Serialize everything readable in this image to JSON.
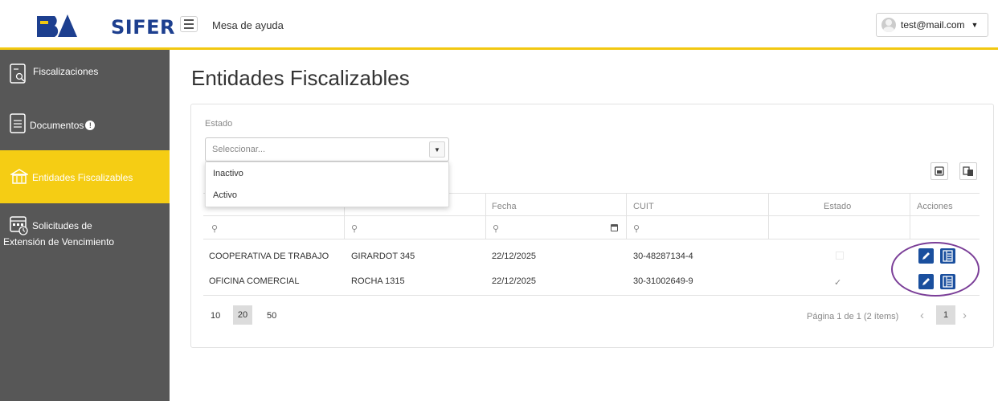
{
  "topbar": {
    "logo_text": "SIFER",
    "title": "Mesa de ayuda",
    "user_email": "test@mail.com",
    "accent_color": "#f2c811"
  },
  "sidebar": {
    "items": [
      {
        "label": "Fiscalizaciones",
        "icon": "document-search-icon"
      },
      {
        "label": "Documentos",
        "icon": "document-icon",
        "badge": "!"
      },
      {
        "label": "Entidades Fiscalizables",
        "icon": "building-icon",
        "active": true
      },
      {
        "label_line1": "Solicitudes de",
        "label_line2": "Extensión de Vencimiento",
        "icon": "calendar-clock-icon"
      }
    ],
    "active_color": "#f5cd14",
    "background": "#575757"
  },
  "main": {
    "title": "Entidades Fiscalizables",
    "filter": {
      "label": "Estado",
      "placeholder": "Seleccionar...",
      "options": [
        "Inactivo",
        "Activo"
      ]
    },
    "table": {
      "columns": [
        "",
        "",
        "Fecha",
        "CUIT",
        "Estado",
        "Acciones"
      ],
      "rows": [
        {
          "entidad": "COOPERATIVA DE TRABAJO",
          "direccion": "GIRARDOT 345",
          "fecha": "22/12/2025",
          "cuit": "30-48287134-4",
          "estado": false
        },
        {
          "entidad": "OFICINA COMERCIAL",
          "direccion": "ROCHA 1315",
          "fecha": "22/12/2025",
          "cuit": "30-31002649-9",
          "estado": true
        }
      ]
    },
    "pager": {
      "sizes": [
        "10",
        "20",
        "50"
      ],
      "selected_size": "20",
      "info": "Página 1 de 1 (2 ítems)",
      "current_page": "1"
    }
  }
}
